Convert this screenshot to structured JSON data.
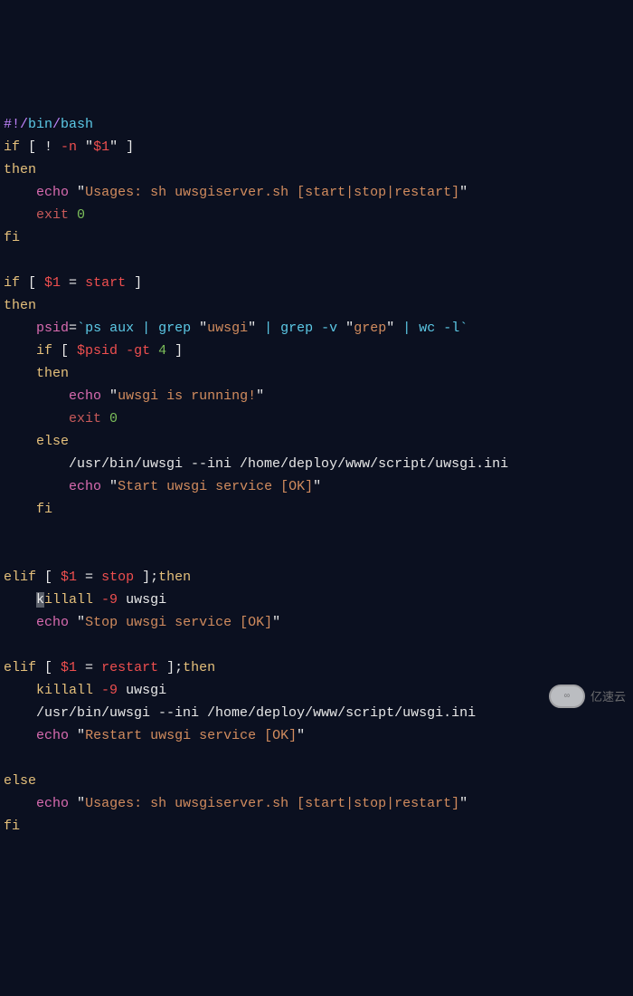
{
  "colors": {
    "bg": "#0b1020",
    "white": "#e8e8e8",
    "cyan": "#5cc9e6",
    "lblue": "#8fb8ff",
    "purple": "#c084fc",
    "red": "#ef4f4f",
    "dimred": "#c95a5a",
    "yellow": "#e5c07b",
    "string": "#d28c5e",
    "magenta": "#d96bb0",
    "green": "#7cbf5a"
  },
  "code": {
    "l01": {
      "shebang_hash": "#!/",
      "shebang_bin": "bin",
      "shebang_slash": "/",
      "shebang_bash": "bash"
    },
    "l02": {
      "kw_if": "if",
      "t1": " [ ! ",
      "neg_n": "-n",
      "t2": " \"",
      "var": "$1",
      "t3": "\" ]"
    },
    "l03": {
      "kw_then": "then"
    },
    "l04": {
      "indent": "    ",
      "echo": "echo",
      "sp": " ",
      "q1": "\"",
      "str": "Usages: sh uwsgiserver.sh [start|stop|restart]",
      "q2": "\""
    },
    "l05": {
      "indent": "    ",
      "kw_exit": "exit",
      "sp": " ",
      "zero": "0"
    },
    "l06": {
      "kw_fi": "fi"
    },
    "l07": {
      "blank": " "
    },
    "l08": {
      "kw_if": "if",
      "t1": " [ ",
      "var": "$1",
      "t2": " = ",
      "start": "start",
      "t3": " ]"
    },
    "l09": {
      "kw_then": "then"
    },
    "l10": {
      "indent": "    ",
      "psid": "psid",
      "eq": "=",
      "bt1": "`",
      "cmd": "ps aux | grep ",
      "q1": "\"",
      "s1": "uwsgi",
      "q2": "\"",
      "mid": " | grep -v ",
      "q3": "\"",
      "s2": "grep",
      "q4": "\"",
      "end": " | wc -l",
      "bt2": "`"
    },
    "l11": {
      "indent": "    ",
      "kw_if": "if",
      "t1": " [ ",
      "var": "$psid",
      "t2": " ",
      "gt": "-gt",
      "t3": " ",
      "num": "4",
      "t4": " ]"
    },
    "l12": {
      "indent": "    ",
      "kw_then": "then"
    },
    "l13": {
      "indent": "        ",
      "echo": "echo",
      "sp": " ",
      "q1": "\"",
      "str": "uwsgi is running!",
      "q2": "\""
    },
    "l14": {
      "indent": "        ",
      "kw_exit": "exit",
      "sp": " ",
      "zero": "0"
    },
    "l15": {
      "indent": "    ",
      "kw_else": "else"
    },
    "l16": {
      "indent": "        ",
      "cmd": "/usr/bin/uwsgi --ini /home/deploy/www/script/uwsgi.ini"
    },
    "l17": {
      "indent": "        ",
      "echo": "echo",
      "sp": " ",
      "q1": "\"",
      "str": "Start uwsgi service [OK]",
      "q2": "\""
    },
    "l18": {
      "indent": "    ",
      "kw_fi": "fi"
    },
    "l19": {
      "blank": " "
    },
    "l20": {
      "blank": " "
    },
    "l21": {
      "kw_elif": "elif",
      "t1": " [ ",
      "var": "$1",
      "t2": " = ",
      "stop": "stop",
      "t3": " ];",
      "kw_then": "then"
    },
    "l22": {
      "indent": "    ",
      "k_hi": "k",
      "rest": "illall ",
      "nine": "-9",
      "sp": " ",
      "uwsgi": "uwsgi"
    },
    "l23": {
      "indent": "    ",
      "echo": "echo",
      "sp": " ",
      "q1": "\"",
      "str": "Stop uwsgi service [OK]",
      "q2": "\""
    },
    "l24": {
      "blank": " "
    },
    "l25": {
      "kw_elif": "elif",
      "t1": " [ ",
      "var": "$1",
      "t2": " = ",
      "restart": "restart",
      "t3": " ];",
      "kw_then": "then"
    },
    "l26": {
      "indent": "    ",
      "killall": "killall ",
      "nine": "-9",
      "sp": " ",
      "uwsgi": "uwsgi"
    },
    "l27": {
      "indent": "    ",
      "cmd": "/usr/bin/uwsgi --ini /home/deploy/www/script/uwsgi.ini"
    },
    "l28": {
      "indent": "    ",
      "echo": "echo",
      "sp": " ",
      "q1": "\"",
      "str": "Restart uwsgi service [OK]",
      "q2": "\""
    },
    "l29": {
      "blank": " "
    },
    "l30": {
      "kw_else": "else"
    },
    "l31": {
      "indent": "    ",
      "echo": "echo",
      "sp": " ",
      "q1": "\"",
      "str": "Usages: sh uwsgiserver.sh [start|stop|restart]",
      "q2": "\""
    },
    "l32": {
      "kw_fi": "fi"
    }
  },
  "watermark": {
    "logo": "∞",
    "text": "亿速云"
  }
}
